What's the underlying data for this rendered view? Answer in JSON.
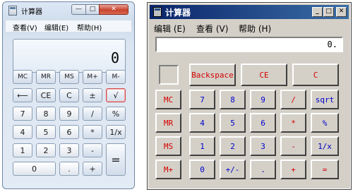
{
  "win7": {
    "title": "计算器",
    "caption": {
      "min": "—",
      "max": "□",
      "close": "✕"
    },
    "menu": [
      "查看(V)",
      "编辑(E)",
      "帮助(H)"
    ],
    "display": "0",
    "keys": {
      "mc": "MC",
      "mr": "MR",
      "ms": "MS",
      "mplus": "M+",
      "mminus": "M-",
      "back": "⟵",
      "ce": "CE",
      "c": "C",
      "pm": "±",
      "sqrt": "√",
      "d7": "7",
      "d8": "8",
      "d9": "9",
      "div": "/",
      "pct": "%",
      "d4": "4",
      "d5": "5",
      "d6": "6",
      "mul": "*",
      "recip": "1/x",
      "d1": "1",
      "d2": "2",
      "d3": "3",
      "sub": "-",
      "eq": "=",
      "d0": "0",
      "dot": ".",
      "add": "+"
    }
  },
  "classic": {
    "title": "计算器",
    "caption": {
      "min": "_",
      "max": "□",
      "close": "✕"
    },
    "menu": [
      "编辑 (E)",
      "查看 (V)",
      "帮助 (H)"
    ],
    "display": "0.",
    "keys": {
      "backspace": "Backspace",
      "ce": "CE",
      "c": "C",
      "mc": "MC",
      "mr": "MR",
      "ms": "MS",
      "mplus": "M+",
      "d7": "7",
      "d8": "8",
      "d9": "9",
      "div": "/",
      "sqrt": "sqrt",
      "d4": "4",
      "d5": "5",
      "d6": "6",
      "mul": "*",
      "pct": "%",
      "d1": "1",
      "d2": "2",
      "d3": "3",
      "sub": "-",
      "recip": "1/x",
      "d0": "0",
      "pm": "+/-",
      "dot": ".",
      "add": "+",
      "eq": "="
    }
  }
}
